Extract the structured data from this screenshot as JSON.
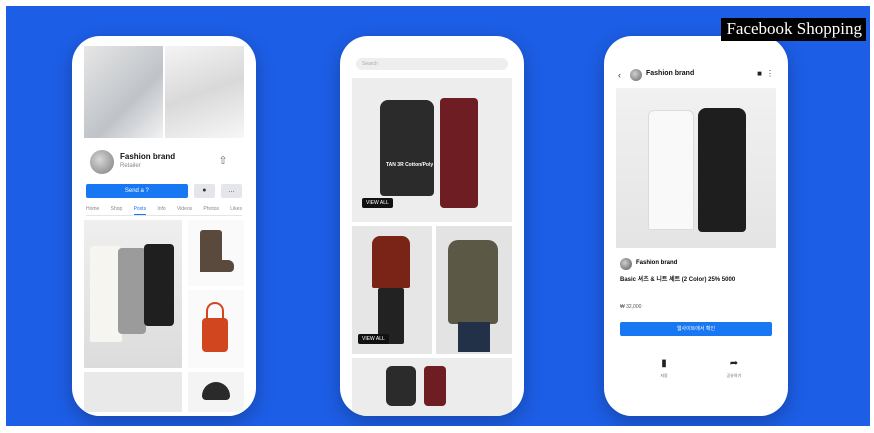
{
  "caption": "Facebook Shopping",
  "phone1": {
    "brand_name": "Fashion brand",
    "brand_sub": "Retailer",
    "primary_button": "Send a ?",
    "tabs": [
      "Home",
      "Shop",
      "Posts",
      "Info",
      "Videos",
      "Photos",
      "Likes"
    ]
  },
  "phone2": {
    "search_placeholder": "Search",
    "main_label": "TAN 3R Cotton/Poly",
    "tag_main": "VIEW ALL",
    "tag_secondary": "VIEW ALL"
  },
  "phone3": {
    "header_title": "Fashion brand",
    "brand_name": "Fashion brand",
    "product_title": "Basic 셔츠 & 니트 세트 (2 Color) 25% 5000",
    "price": "₩ 32,000",
    "cta": "웹사이트에서 확인",
    "actions": [
      {
        "icon": "save-icon",
        "label": "저장"
      },
      {
        "icon": "share-icon",
        "label": "공유하기"
      }
    ]
  }
}
